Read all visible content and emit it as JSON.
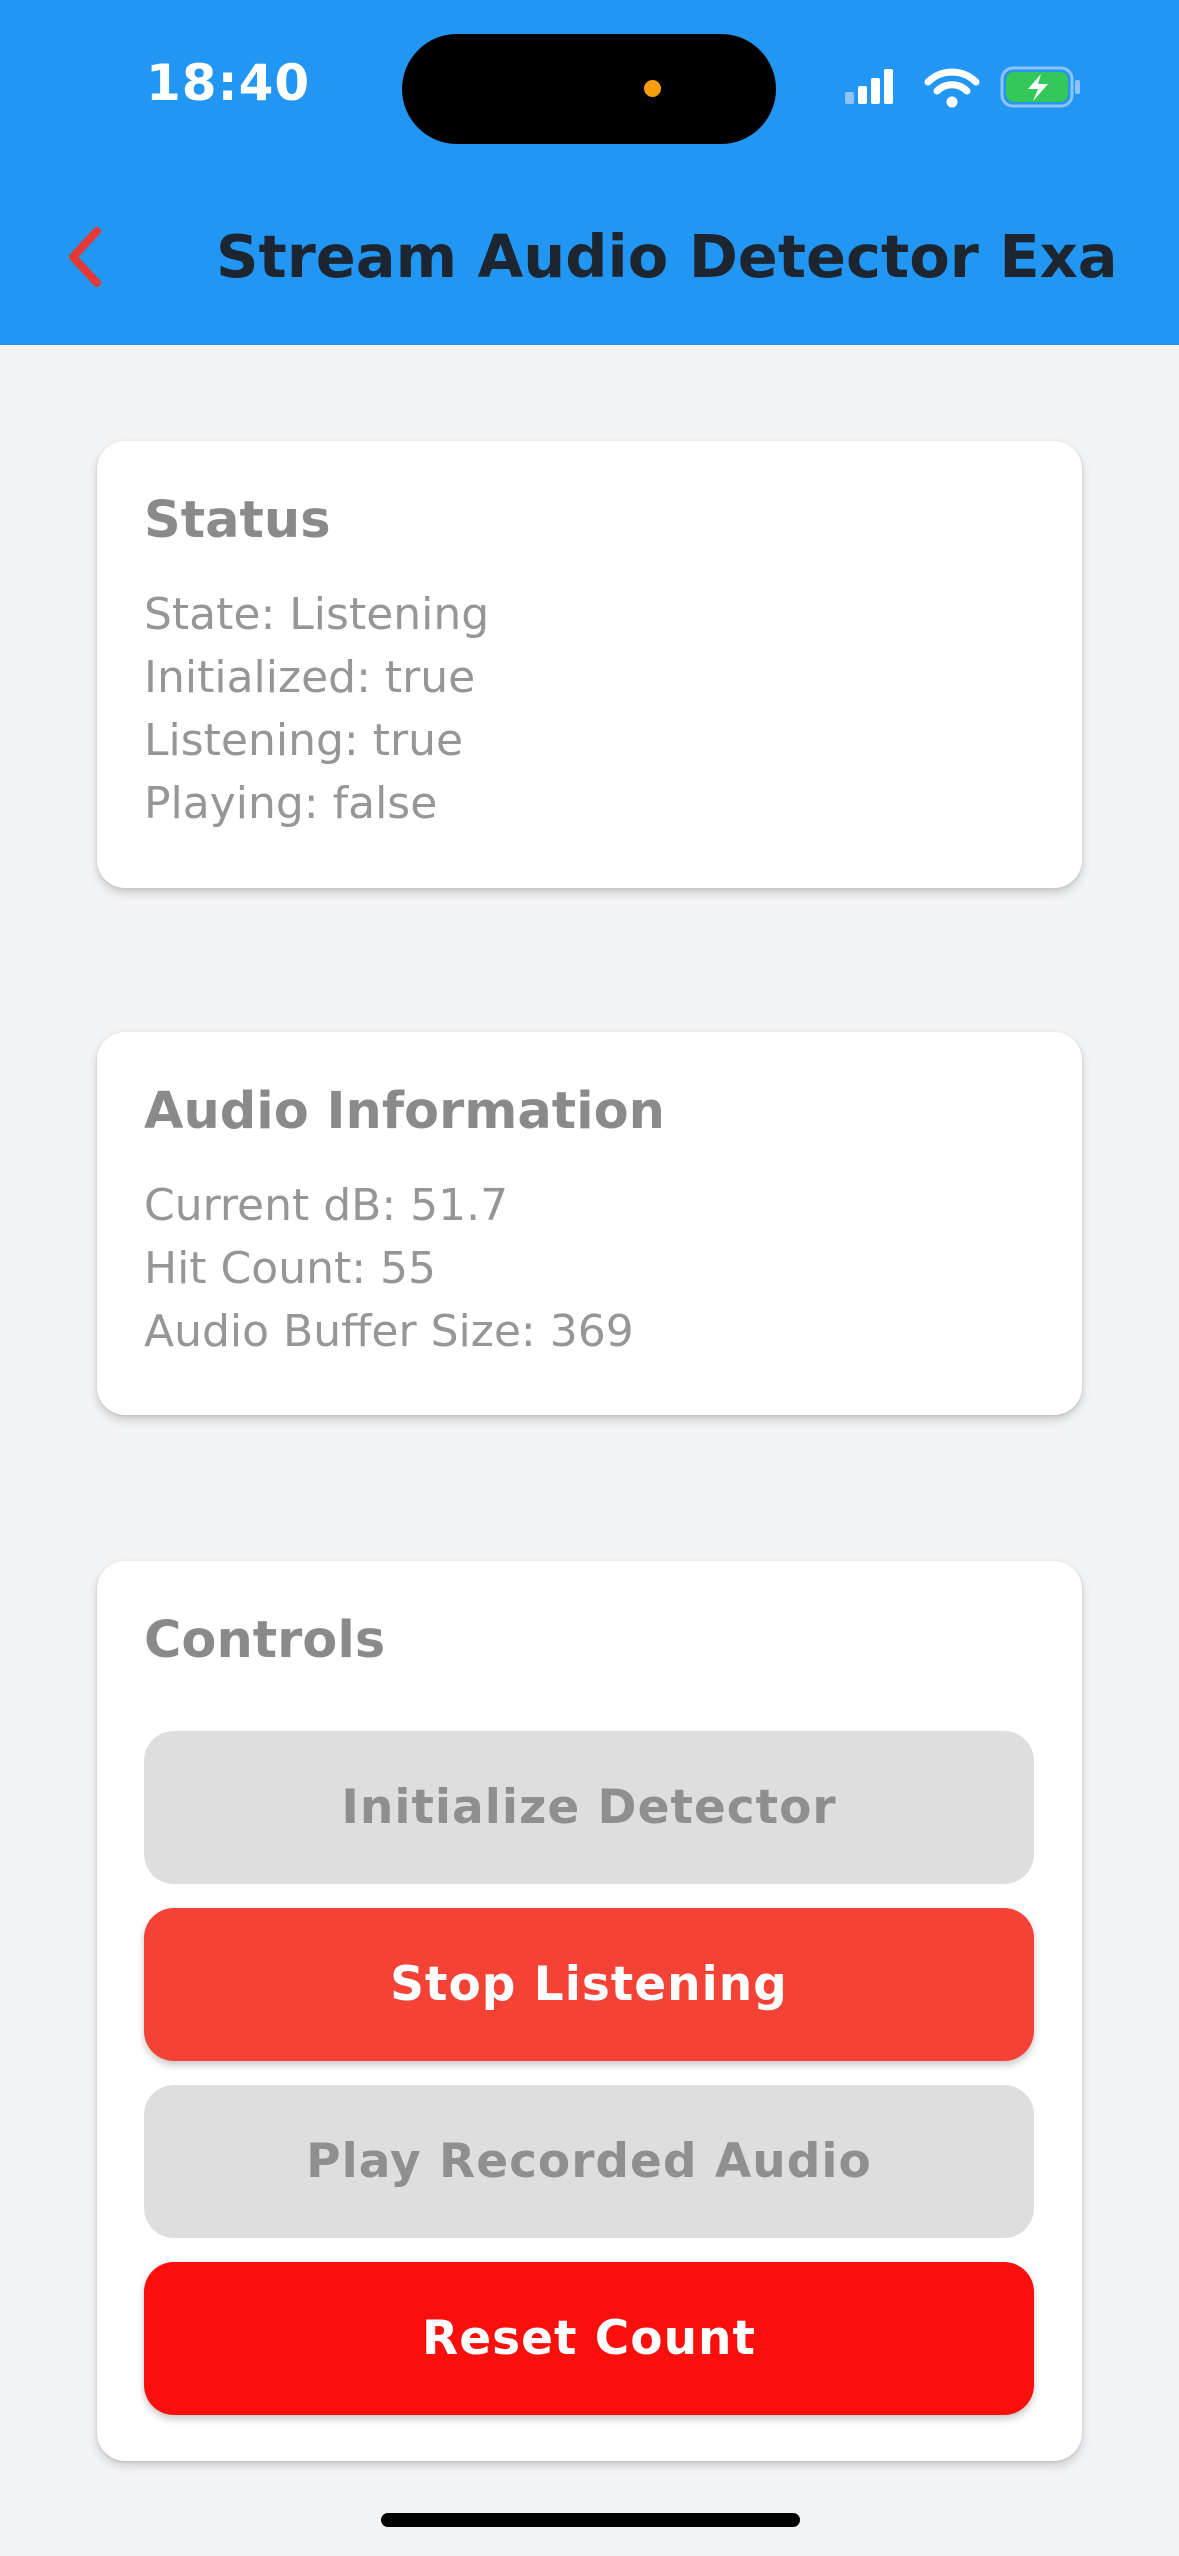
{
  "status_bar": {
    "time": "18:40",
    "icons": [
      "cellular-signal-icon",
      "wifi-icon",
      "battery-charging-icon"
    ]
  },
  "app_bar": {
    "title": "Stream Audio Detector Exam...",
    "back_icon": "chevron-left-icon",
    "back_icon_color": "#e53935",
    "background": "#2196f3"
  },
  "status_card": {
    "title": "Status",
    "lines": [
      "State: Listening",
      "Initialized: true",
      "Listening: true",
      "Playing: false"
    ]
  },
  "audio_card": {
    "title": "Audio Information",
    "lines": [
      "Current dB: 51.7",
      "Hit Count: 55",
      "Audio Buffer Size: 369"
    ]
  },
  "controls_card": {
    "title": "Controls",
    "buttons": [
      {
        "label": "Initialize Detector",
        "enabled": false,
        "color": "#dedede"
      },
      {
        "label": "Stop Listening",
        "enabled": true,
        "color": "#f44336"
      },
      {
        "label": "Play Recorded Audio",
        "enabled": false,
        "color": "#dedede"
      },
      {
        "label": "Reset Count",
        "enabled": true,
        "color": "#fb0f0c"
      }
    ]
  }
}
